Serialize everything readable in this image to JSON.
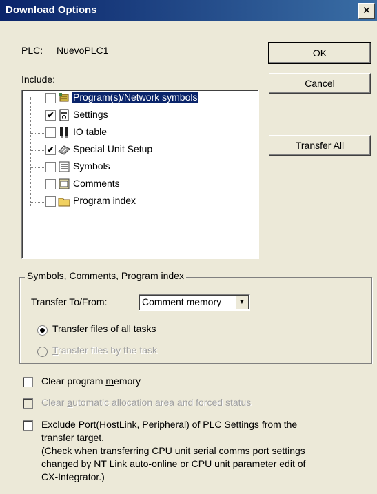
{
  "window": {
    "title": "Download Options",
    "close_glyph": "✕"
  },
  "plc": {
    "label": "PLC:",
    "name": "NuevoPLC1"
  },
  "include_label": "Include:",
  "buttons": {
    "ok": "OK",
    "cancel": "Cancel",
    "transfer_all": "Transfer All"
  },
  "tree": {
    "items": [
      {
        "label": "Program(s)/Network symbols",
        "checked": false,
        "selected": true,
        "icon": "program-icon"
      },
      {
        "label": "Settings",
        "checked": true,
        "selected": false,
        "icon": "settings-icon"
      },
      {
        "label": "IO table",
        "checked": false,
        "selected": false,
        "icon": "io-table-icon"
      },
      {
        "label": "Special Unit Setup",
        "checked": true,
        "selected": false,
        "icon": "special-unit-icon"
      },
      {
        "label": "Symbols",
        "checked": false,
        "selected": false,
        "icon": "symbols-icon"
      },
      {
        "label": "Comments",
        "checked": false,
        "selected": false,
        "icon": "comments-icon"
      },
      {
        "label": "Program index",
        "checked": false,
        "selected": false,
        "icon": "folder-icon"
      }
    ]
  },
  "group": {
    "title": "Symbols, Comments, Program index",
    "transfer_label": "Transfer To/From:",
    "transfer_value": "Comment memory",
    "radio_all_pre": "Transfer files of ",
    "radio_all_key": "all",
    "radio_all_post": " tasks",
    "radio_task_key": "T",
    "radio_task_post": "ransfer files by the task"
  },
  "options": {
    "clear_pre": "Clear program ",
    "clear_key": "m",
    "clear_post": "emory",
    "clear_auto_pre": "Clear ",
    "clear_auto_key": "a",
    "clear_auto_post": "utomatic allocation area and forced status",
    "exclude_pre": "Exclude ",
    "exclude_key": "P",
    "exclude_post": "ort(HostLink, Peripheral) of PLC Settings from the",
    "exclude_line2": "transfer target.",
    "exclude_line3": "(Check when transferring CPU unit serial comms port settings",
    "exclude_line4": "changed by NT Link auto-online or CPU unit parameter edit of",
    "exclude_line5": "CX-Integrator.)"
  },
  "colors": {
    "titlebar": "#0a246a",
    "face": "#ece9d8",
    "selection": "#0a246a"
  }
}
